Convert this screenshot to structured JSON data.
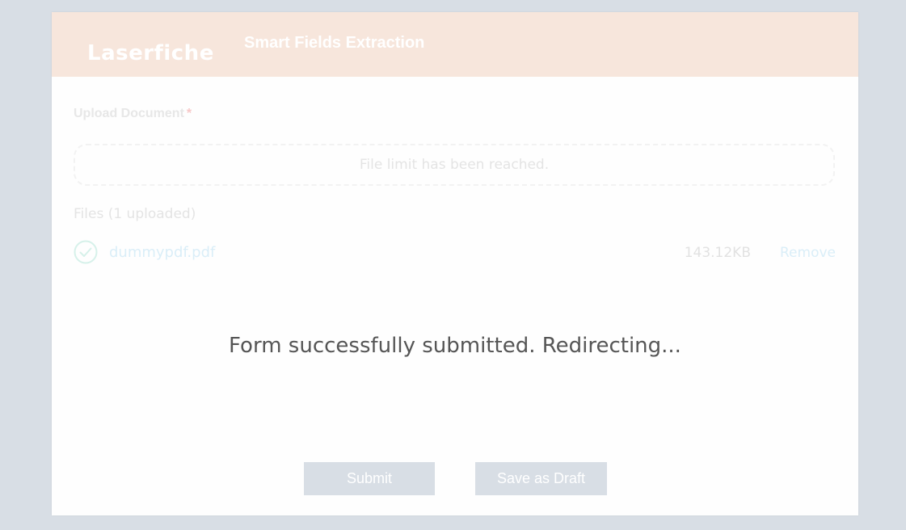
{
  "header": {
    "logo_text": "Laserfiche",
    "title": "Smart Fields Extraction",
    "background_color": "#f7e6dc"
  },
  "upload_field": {
    "label": "Upload Document",
    "required_mark": "*",
    "dropzone_text": "File limit has been reached.",
    "files_count_text": "Files (1 uploaded)"
  },
  "files": [
    {
      "status_icon": "check-circle-icon",
      "name": "dummypdf.pdf",
      "size": "143.12KB",
      "remove_label": "Remove"
    }
  ],
  "status_message": "Form successfully submitted. Redirecting...",
  "buttons": {
    "submit_label": "Submit",
    "draft_label": "Save as Draft"
  },
  "colors": {
    "page_background": "#d8dee5",
    "button_background": "#d8dee5",
    "check_icon": "#d6f1ea"
  }
}
